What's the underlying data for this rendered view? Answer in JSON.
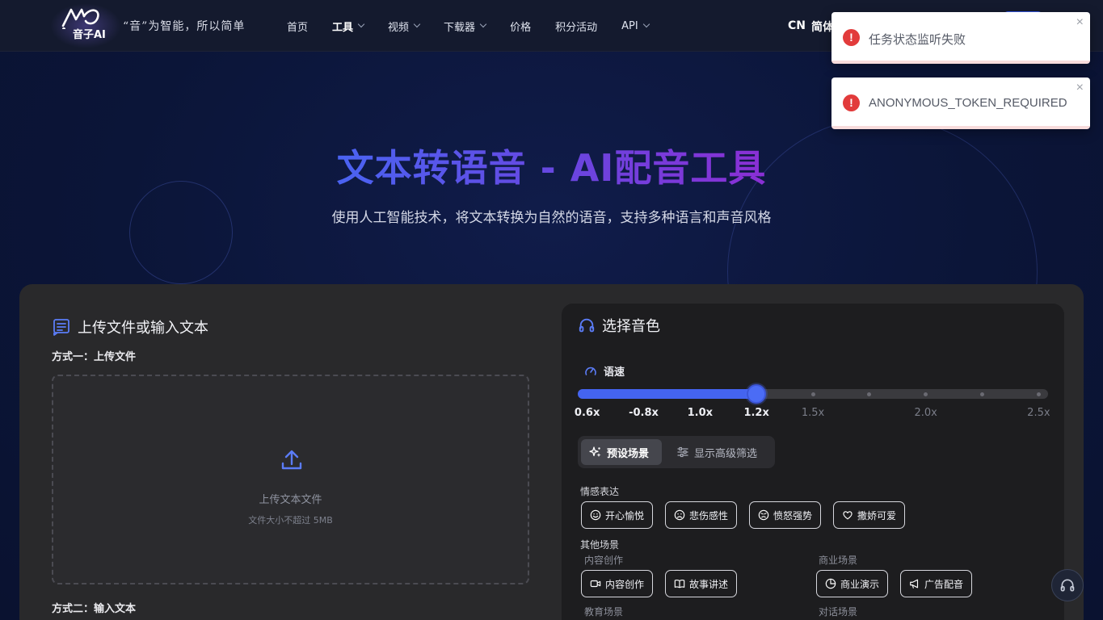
{
  "header": {
    "logo_text": "音子AI",
    "slogan": "“音”为智能，所以简单",
    "nav": [
      {
        "label": "首页",
        "has_dropdown": false,
        "active": false
      },
      {
        "label": "工具",
        "has_dropdown": true,
        "active": true
      },
      {
        "label": "视频",
        "has_dropdown": true,
        "active": false
      },
      {
        "label": "下载器",
        "has_dropdown": true,
        "active": false
      },
      {
        "label": "价格",
        "has_dropdown": false,
        "active": false
      },
      {
        "label": "积分活动",
        "has_dropdown": false,
        "active": false
      },
      {
        "label": "API",
        "has_dropdown": true,
        "active": false
      }
    ],
    "lang_code": "CN",
    "lang_name": "简体"
  },
  "toasts": [
    {
      "icon": "error-icon",
      "message": "任务状态监听失败",
      "close": "×"
    },
    {
      "icon": "error-icon",
      "message": "ANONYMOUS_TOKEN_REQUIRED",
      "close": "×"
    }
  ],
  "hero": {
    "title": "文本转语音 - AI配音工具",
    "subtitle": "使用人工智能技术，将文本转换为自然的语音，支持多种语言和声音风格"
  },
  "upload": {
    "section_title": "上传文件或输入文本",
    "method1_label": "方式一：上传文件",
    "upload_text": "上传文本文件",
    "upload_hint": "文件大小不超过 5MB",
    "method2_label": "方式二：输入文本"
  },
  "voice": {
    "section_title": "选择音色",
    "speed_label": "语速",
    "speed": {
      "selected": "1.2x",
      "ticks": [
        "0.6x",
        "-0.8x",
        "1.0x",
        "1.2x",
        "1.5x",
        "2.0x",
        "2.5x"
      ]
    },
    "tabs": [
      {
        "label": "预设场景",
        "active": true
      },
      {
        "label": "显示高级筛选",
        "active": false
      }
    ],
    "emotion_label": "情感表达",
    "emotion_chips": [
      {
        "label": "开心愉悦",
        "icon": "smile-icon"
      },
      {
        "label": "悲伤感性",
        "icon": "sad-icon"
      },
      {
        "label": "愤怒强势",
        "icon": "angry-icon"
      },
      {
        "label": "撒娇可爱",
        "icon": "heart-icon"
      }
    ],
    "other_label": "其他场景",
    "content_group": "内容创作",
    "content_chips": [
      {
        "label": "内容创作",
        "icon": "video-icon"
      },
      {
        "label": "故事讲述",
        "icon": "book-icon"
      }
    ],
    "business_group": "商业场景",
    "business_chips": [
      {
        "label": "商业演示",
        "icon": "pie-chart-icon"
      },
      {
        "label": "广告配音",
        "icon": "megaphone-icon"
      }
    ],
    "education_group": "教育场景",
    "dialogue_group": "对话场景"
  },
  "colors": {
    "accent": "#4464f0",
    "error": "#e23b3b",
    "title_gradient_start": "#4a63f2",
    "title_gradient_end": "#8a2fd4"
  }
}
